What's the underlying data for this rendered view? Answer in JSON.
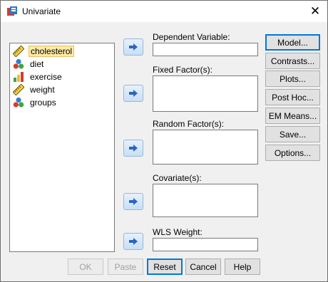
{
  "window": {
    "title": "Univariate"
  },
  "variables": [
    {
      "label": "cholesterol",
      "icon": "scale-ruler-icon",
      "selected": true
    },
    {
      "label": "diet",
      "icon": "nominal-circles-icon",
      "selected": false
    },
    {
      "label": "exercise",
      "icon": "ordinal-bars-icon",
      "selected": false
    },
    {
      "label": "weight",
      "icon": "scale-ruler-icon",
      "selected": false
    },
    {
      "label": "groups",
      "icon": "nominal-circles-icon",
      "selected": false
    }
  ],
  "fields": {
    "dependent": {
      "label": "Dependent Variable:",
      "value": ""
    },
    "fixed": {
      "label": "Fixed Factor(s):",
      "value": ""
    },
    "random": {
      "label": "Random Factor(s):",
      "value": ""
    },
    "covariate": {
      "label": "Covariate(s):",
      "value": ""
    },
    "wls": {
      "label": "WLS Weight:",
      "value": ""
    }
  },
  "side_buttons": {
    "model": "Model...",
    "contrasts": "Contrasts...",
    "plots": "Plots...",
    "posthoc": "Post Hoc...",
    "emmeans": "EM Means...",
    "save": "Save...",
    "options": "Options..."
  },
  "bottom_buttons": {
    "ok": "OK",
    "paste": "Paste",
    "reset": "Reset",
    "cancel": "Cancel",
    "help": "Help"
  }
}
